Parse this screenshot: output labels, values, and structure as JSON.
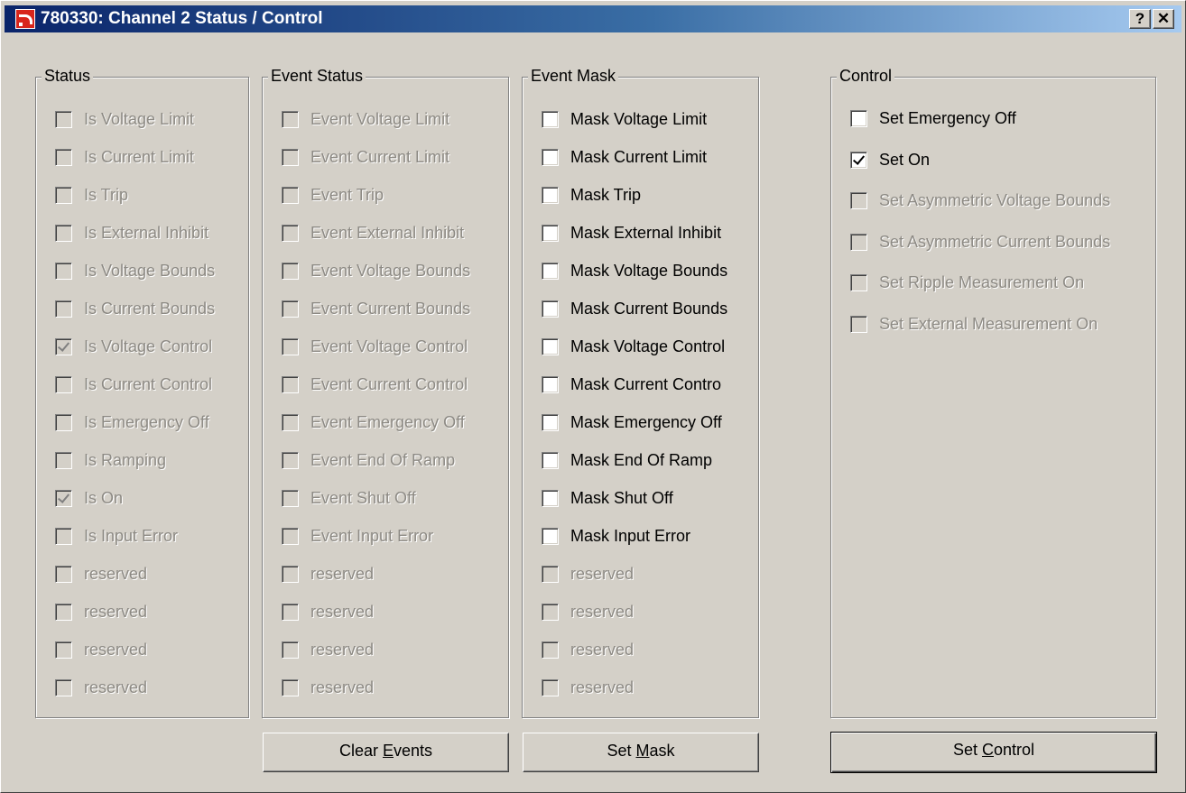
{
  "window": {
    "title": "780330: Channel 2 Status / Control",
    "help_button": "?",
    "close_button": "✕"
  },
  "status": {
    "title": "Status",
    "items": [
      {
        "label": "Is Voltage Limit",
        "checked": false,
        "enabled": false
      },
      {
        "label": "Is Current Limit",
        "checked": false,
        "enabled": false
      },
      {
        "label": "Is Trip",
        "checked": false,
        "enabled": false
      },
      {
        "label": "Is External Inhibit",
        "checked": false,
        "enabled": false
      },
      {
        "label": "Is Voltage Bounds",
        "checked": false,
        "enabled": false
      },
      {
        "label": "Is Current Bounds",
        "checked": false,
        "enabled": false
      },
      {
        "label": "Is Voltage Control",
        "checked": true,
        "enabled": false
      },
      {
        "label": "Is Current Control",
        "checked": false,
        "enabled": false
      },
      {
        "label": "Is Emergency Off",
        "checked": false,
        "enabled": false
      },
      {
        "label": "Is Ramping",
        "checked": false,
        "enabled": false
      },
      {
        "label": "Is On",
        "checked": true,
        "enabled": false
      },
      {
        "label": "Is Input Error",
        "checked": false,
        "enabled": false
      },
      {
        "label": "reserved",
        "checked": false,
        "enabled": false
      },
      {
        "label": "reserved",
        "checked": false,
        "enabled": false
      },
      {
        "label": "reserved",
        "checked": false,
        "enabled": false
      },
      {
        "label": "reserved",
        "checked": false,
        "enabled": false
      }
    ]
  },
  "event_status": {
    "title": "Event Status",
    "items": [
      {
        "label": "Event Voltage Limit",
        "checked": false,
        "enabled": false
      },
      {
        "label": "Event Current Limit",
        "checked": false,
        "enabled": false
      },
      {
        "label": "Event Trip",
        "checked": false,
        "enabled": false
      },
      {
        "label": "Event External Inhibit",
        "checked": false,
        "enabled": false
      },
      {
        "label": "Event Voltage Bounds",
        "checked": false,
        "enabled": false
      },
      {
        "label": "Event Current Bounds",
        "checked": false,
        "enabled": false
      },
      {
        "label": "Event Voltage Control",
        "checked": false,
        "enabled": false
      },
      {
        "label": "Event Current Control",
        "checked": false,
        "enabled": false
      },
      {
        "label": "Event Emergency Off",
        "checked": false,
        "enabled": false
      },
      {
        "label": "Event End Of Ramp",
        "checked": false,
        "enabled": false
      },
      {
        "label": "Event Shut Off",
        "checked": false,
        "enabled": false
      },
      {
        "label": "Event Input Error",
        "checked": false,
        "enabled": false
      },
      {
        "label": "reserved",
        "checked": false,
        "enabled": false
      },
      {
        "label": "reserved",
        "checked": false,
        "enabled": false
      },
      {
        "label": "reserved",
        "checked": false,
        "enabled": false
      },
      {
        "label": "reserved",
        "checked": false,
        "enabled": false
      }
    ]
  },
  "event_mask": {
    "title": "Event Mask",
    "items": [
      {
        "label": "Mask Voltage Limit",
        "checked": false,
        "enabled": true
      },
      {
        "label": "Mask Current Limit",
        "checked": false,
        "enabled": true
      },
      {
        "label": "Mask Trip",
        "checked": false,
        "enabled": true
      },
      {
        "label": "Mask External Inhibit",
        "checked": false,
        "enabled": true
      },
      {
        "label": "Mask Voltage Bounds",
        "checked": false,
        "enabled": true
      },
      {
        "label": "Mask Current Bounds",
        "checked": false,
        "enabled": true
      },
      {
        "label": "Mask Voltage Control",
        "checked": false,
        "enabled": true
      },
      {
        "label": "Mask Current Contro",
        "checked": false,
        "enabled": true
      },
      {
        "label": "Mask Emergency Off",
        "checked": false,
        "enabled": true
      },
      {
        "label": "Mask End Of Ramp",
        "checked": false,
        "enabled": true
      },
      {
        "label": "Mask Shut Off",
        "checked": false,
        "enabled": true
      },
      {
        "label": "Mask Input Error",
        "checked": false,
        "enabled": true
      },
      {
        "label": "reserved",
        "checked": false,
        "enabled": false
      },
      {
        "label": "reserved",
        "checked": false,
        "enabled": false
      },
      {
        "label": "reserved",
        "checked": false,
        "enabled": false
      },
      {
        "label": "reserved",
        "checked": false,
        "enabled": false
      }
    ]
  },
  "control": {
    "title": "Control",
    "items": [
      {
        "label": "Set Emergency Off",
        "checked": false,
        "enabled": true
      },
      {
        "label": "Set On",
        "checked": true,
        "enabled": true
      },
      {
        "label": "Set Asymmetric Voltage Bounds",
        "checked": false,
        "enabled": false
      },
      {
        "label": "Set Asymmetric Current Bounds",
        "checked": false,
        "enabled": false
      },
      {
        "label": "Set Ripple Measurement On",
        "checked": false,
        "enabled": false
      },
      {
        "label": "Set External Measurement On",
        "checked": false,
        "enabled": false
      }
    ]
  },
  "buttons": {
    "clear_events": {
      "before": "Clear ",
      "mnemonic": "E",
      "after": "vents"
    },
    "set_mask": {
      "before": "Set ",
      "mnemonic": "M",
      "after": "ask"
    },
    "set_control": {
      "before": "Set ",
      "mnemonic": "C",
      "after": "ontrol"
    }
  },
  "colors": {
    "face": "#d4d0c8",
    "title_start": "#0a246a",
    "title_end": "#a6caf0",
    "disabled_text": "#8d8a84"
  }
}
